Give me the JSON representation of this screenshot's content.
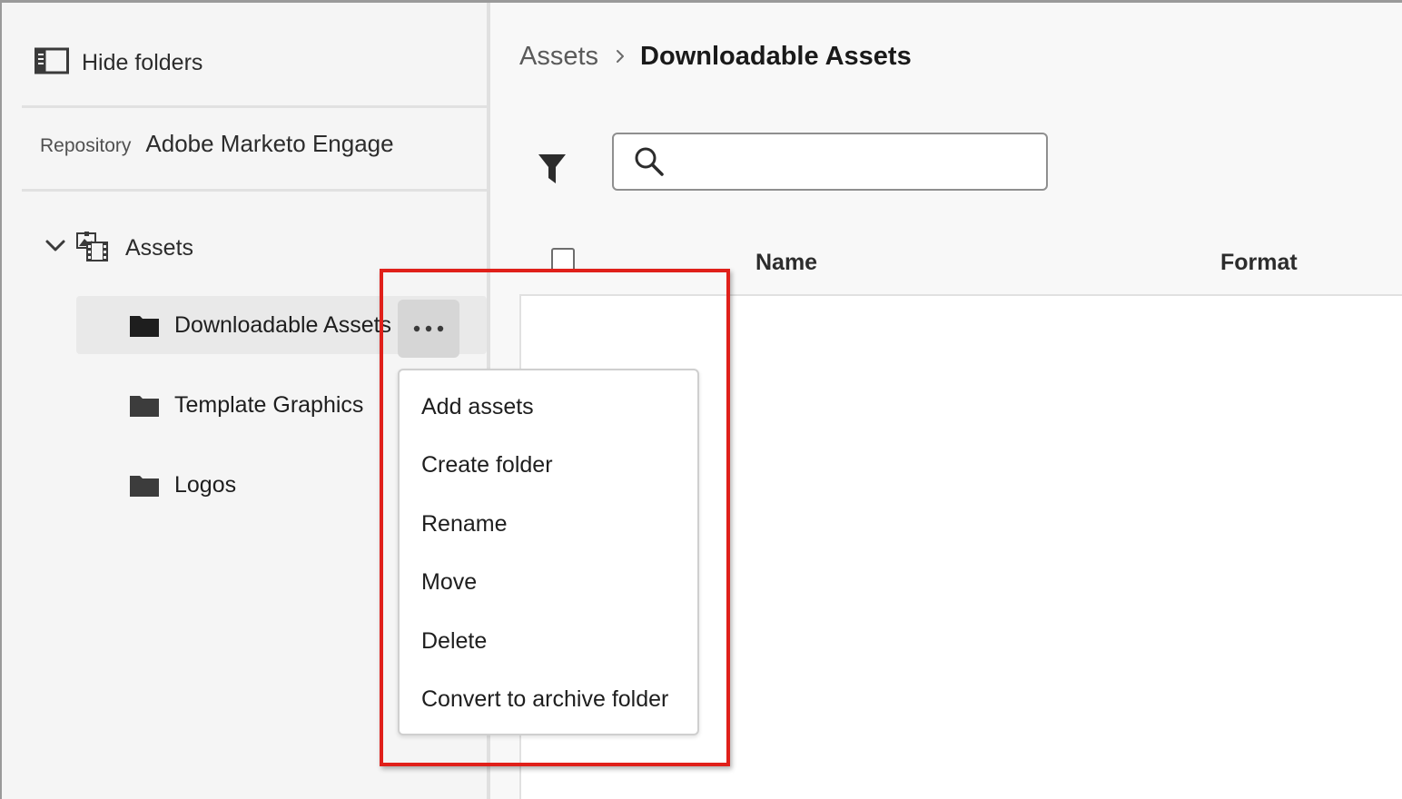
{
  "sidebar": {
    "hide_folders_label": "Hide folders",
    "repository": {
      "label": "Repository",
      "value": "Adobe Marketo Engage"
    },
    "tree": {
      "root_label": "Assets",
      "items": [
        {
          "label": "Downloadable Assets",
          "selected": true
        },
        {
          "label": "Template Graphics",
          "selected": false
        },
        {
          "label": "Logos",
          "selected": false
        }
      ]
    },
    "more_actions_icon": "ellipsis-icon"
  },
  "breadcrumb": {
    "parent": "Assets",
    "current": "Downloadable Assets"
  },
  "toolbar": {
    "filter_icon": "filter-icon",
    "search": {
      "icon": "search-icon",
      "value": "",
      "placeholder": ""
    }
  },
  "table": {
    "columns": [
      "Name",
      "Format"
    ]
  },
  "context_menu": {
    "items": [
      "Add assets",
      "Create folder",
      "Rename",
      "Move",
      "Delete",
      "Convert to archive folder"
    ]
  },
  "colors": {
    "highlight": "#e0201a",
    "selected_row": "#e9e9e9",
    "more_button": "#d6d6d6"
  }
}
